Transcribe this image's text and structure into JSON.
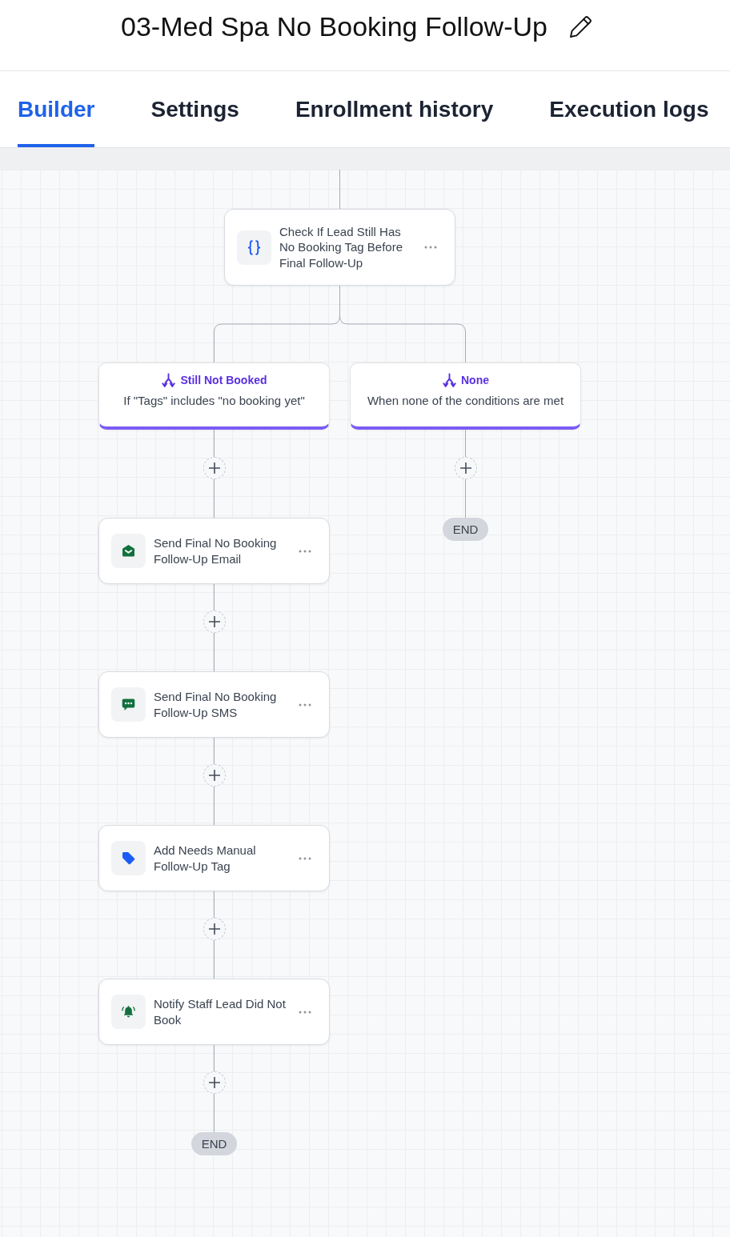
{
  "header": {
    "title": "03-Med Spa No Booking Follow-Up"
  },
  "tabs": [
    {
      "label": "Builder",
      "selected": true
    },
    {
      "label": "Settings",
      "selected": false
    },
    {
      "label": "Enrollment history",
      "selected": false
    },
    {
      "label": "Execution logs",
      "selected": false
    }
  ],
  "workflow": {
    "condition": {
      "title": "Check If Lead Still Has No Booking Tag Before Final Follow-Up"
    },
    "branches": [
      {
        "title": "Still Not Booked",
        "description": "If \"Tags\" includes \"no booking yet\"",
        "steps": [
          {
            "kind": "email",
            "title": "Send Final No Booking Follow-Up Email"
          },
          {
            "kind": "sms",
            "title": "Send Final No Booking Follow-Up SMS"
          },
          {
            "kind": "tag",
            "title": "Add Needs Manual Follow-Up Tag"
          },
          {
            "kind": "notification",
            "title": "Notify Staff Lead Did Not Book"
          }
        ],
        "end": "END"
      },
      {
        "title": "None",
        "description": "When none of the conditions are met",
        "end": "END"
      }
    ]
  }
}
